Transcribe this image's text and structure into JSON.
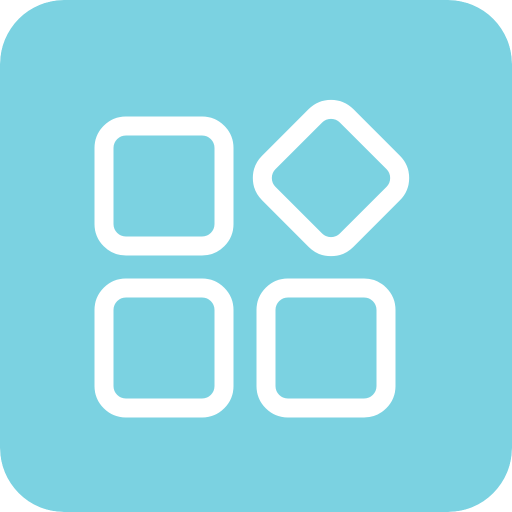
{
  "icon": {
    "name": "apps-grid-icon",
    "background_color": "#7BD2E1",
    "glyph_color": "#FFFFFF"
  }
}
